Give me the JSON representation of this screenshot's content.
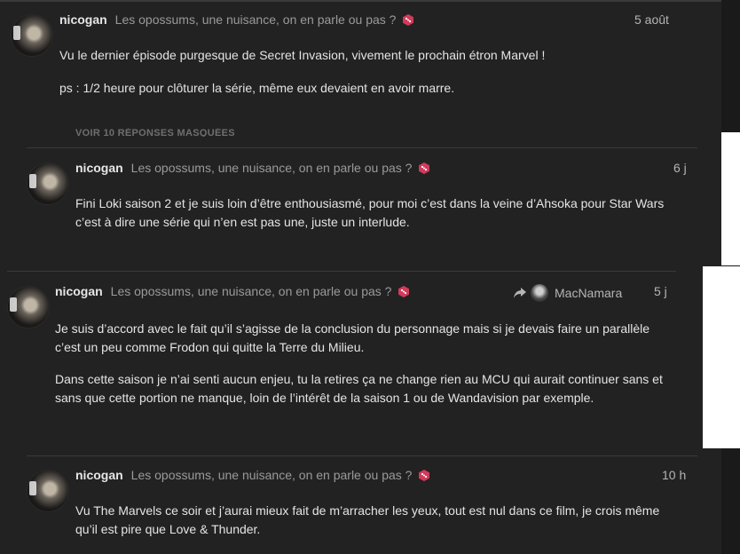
{
  "posts": [
    {
      "username": "nicogan",
      "topic": "Les opossums, une nuisance, on en parle ou pas ?",
      "date": "5 août",
      "paragraphs": [
        "Vu le dernier épisode purgesque de Secret Invasion, vivement le prochain étron Marvel !",
        "ps : 1/2 heure pour clôturer la série, même eux devaient en avoir marre."
      ]
    },
    {
      "username": "nicogan",
      "topic": "Les opossums, une nuisance, on en parle ou pas ?",
      "date": "6 j",
      "paragraphs": [
        "Fini Loki saison 2 et je suis loin d’être enthousiasmé, pour moi c’est dans la veine d’Ahsoka pour Star Wars c’est à dire une série qui n’en est pas une, juste un interlude."
      ]
    },
    {
      "username": "nicogan",
      "topic": "Les opossums, une nuisance, on en parle ou pas ?",
      "date": "5 j",
      "reply_to": "MacNamara",
      "paragraphs": [
        "Je suis d’accord avec le fait qu’il s’agisse de la conclusion du personnage mais si je devais faire un parallèle c’est un peu comme Frodon qui quitte la Terre du Milieu.",
        "Dans cette saison je n’ai senti aucun enjeu, tu la retires ça ne change rien au MCU qui aurait continuer sans et sans que cette portion ne manque, loin de l’intérêt de la saison 1 ou de Wandavision par exemple."
      ]
    },
    {
      "username": "nicogan",
      "topic": "Les opossums, une nuisance, on en parle ou pas ?",
      "date": "10 h",
      "paragraphs": [
        "Vu The Marvels ce soir et j’aurai mieux fait de m’arracher les yeux, tout est nul dans ce film, je crois même qu’il est pire que Love & Thunder."
      ]
    }
  ],
  "hidden_replies_label": "VOIR 10 RÉPONSES MASQUÉES",
  "icons": {
    "avatar": "avatar-icon",
    "dice": "dice-icon",
    "reply": "reply-arrow-icon"
  },
  "colors": {
    "background": "#222222",
    "dice": "#d23a5a",
    "topic": "#9a9a9a"
  }
}
